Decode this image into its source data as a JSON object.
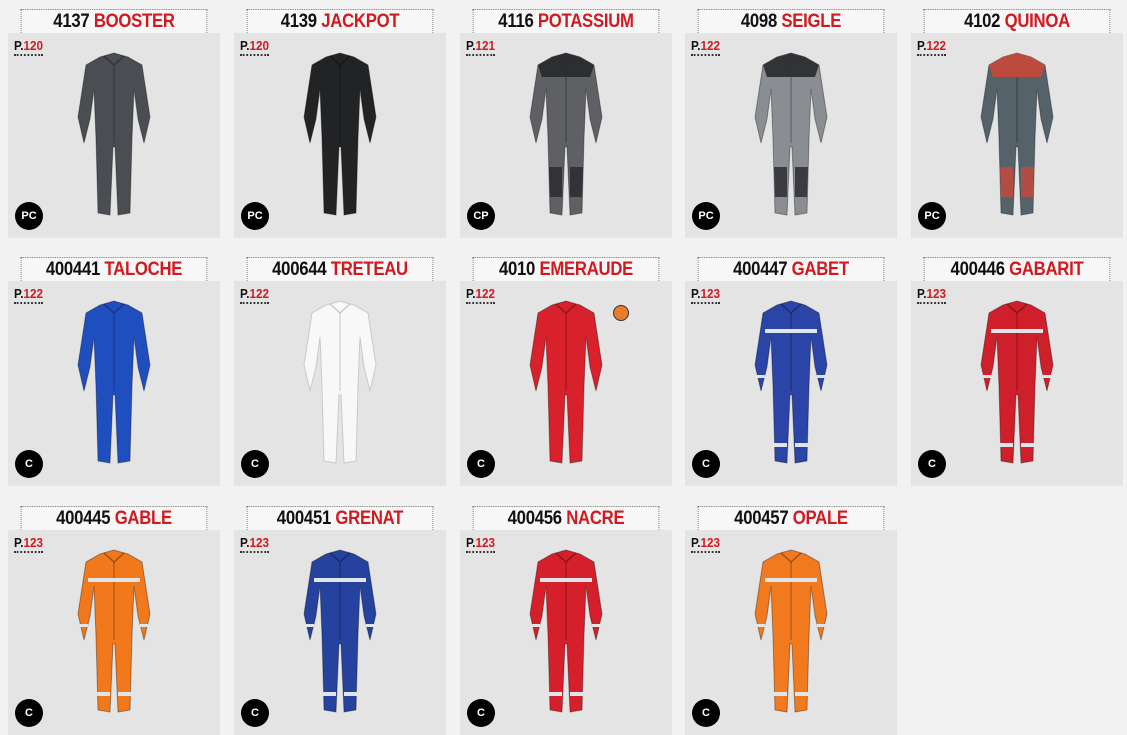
{
  "products": [
    {
      "code": "4137",
      "name": "BOOSTER",
      "page_prefix": "P.",
      "page": "120",
      "badge": "PC",
      "color": "#4a4d52",
      "accent": "#4a4d52",
      "reflective": false
    },
    {
      "code": "4139",
      "name": "JACKPOT",
      "page_prefix": "P.",
      "page": "120",
      "badge": "PC",
      "color": "#222325",
      "accent": "#222325",
      "reflective": false
    },
    {
      "code": "4116",
      "name": "POTASSIUM",
      "page_prefix": "P.",
      "page": "121",
      "badge": "CP",
      "color": "#5e6064",
      "accent": "#2a2b2e",
      "reflective": false
    },
    {
      "code": "4098",
      "name": "SEIGLE",
      "page_prefix": "P.",
      "page": "122",
      "badge": "PC",
      "color": "#8a8d92",
      "accent": "#2d2e31",
      "reflective": false
    },
    {
      "code": "4102",
      "name": "QUINOA",
      "page_prefix": "P.",
      "page": "122",
      "badge": "PC",
      "color": "#56626a",
      "accent": "#c24a3c",
      "reflective": false
    },
    {
      "code": "400441",
      "name": "TALOCHE",
      "page_prefix": "P.",
      "page": "122",
      "badge": "C",
      "color": "#1f4fbf",
      "accent": "#1f4fbf",
      "reflective": false
    },
    {
      "code": "400644",
      "name": "TRETEAU",
      "page_prefix": "P.",
      "page": "122",
      "badge": "C",
      "color": "#f8f8f8",
      "accent": "#f8f8f8",
      "reflective": false
    },
    {
      "code": "4010",
      "name": "EMERAUDE",
      "page_prefix": "P.",
      "page": "122",
      "badge": "C",
      "color": "#d8212b",
      "accent": "#d8212b",
      "reflective": false
    },
    {
      "code": "400447",
      "name": "GABET",
      "page_prefix": "P.",
      "page": "123",
      "badge": "C",
      "color": "#2a44a8",
      "accent": "#2a44a8",
      "reflective": true
    },
    {
      "code": "400446",
      "name": "GABARIT",
      "page_prefix": "P.",
      "page": "123",
      "badge": "C",
      "color": "#cf1f2b",
      "accent": "#cf1f2b",
      "reflective": true
    },
    {
      "code": "400445",
      "name": "GABLE",
      "page_prefix": "P.",
      "page": "123",
      "badge": "C",
      "color": "#f2781c",
      "accent": "#f2781c",
      "reflective": true
    },
    {
      "code": "400451",
      "name": "GRENAT",
      "page_prefix": "P.",
      "page": "123",
      "badge": "C",
      "color": "#24429e",
      "accent": "#24429e",
      "reflective": true
    },
    {
      "code": "400456",
      "name": "NACRE",
      "page_prefix": "P.",
      "page": "123",
      "badge": "C",
      "color": "#d51f2a",
      "accent": "#d51f2a",
      "reflective": true
    },
    {
      "code": "400457",
      "name": "OPALE",
      "page_prefix": "P.",
      "page": "123",
      "badge": "C",
      "color": "#f27a1e",
      "accent": "#f27a1e",
      "reflective": true
    }
  ],
  "colors": {
    "brand_red": "#d01a20",
    "marker_orange": "#e87d2e"
  }
}
